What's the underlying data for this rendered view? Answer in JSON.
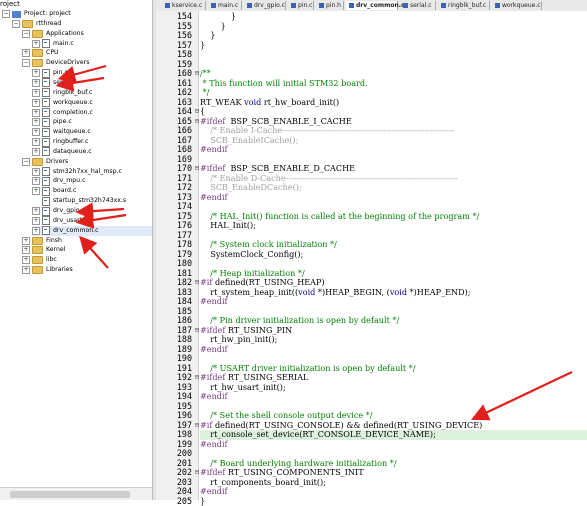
{
  "project_pane": {
    "title": "roject",
    "tree": [
      {
        "label": "Project: project",
        "kind": "project",
        "indent": 0,
        "pm": "-"
      },
      {
        "label": "rtthread",
        "kind": "folder",
        "indent": 1,
        "pm": "-"
      },
      {
        "label": "Applications",
        "kind": "folder",
        "indent": 2,
        "pm": "-"
      },
      {
        "label": "main.c",
        "kind": "file",
        "indent": 3,
        "pm": "+"
      },
      {
        "label": "CPU",
        "kind": "folder",
        "indent": 2,
        "pm": "+"
      },
      {
        "label": "DeviceDrivers",
        "kind": "folder",
        "indent": 2,
        "pm": "-"
      },
      {
        "label": "pin.c",
        "kind": "file",
        "indent": 3,
        "pm": "+"
      },
      {
        "label": "serial.c",
        "kind": "file",
        "indent": 3,
        "pm": "+"
      },
      {
        "label": "ringblk_buf.c",
        "kind": "file",
        "indent": 3,
        "pm": "+"
      },
      {
        "label": "workqueue.c",
        "kind": "file",
        "indent": 3,
        "pm": "+"
      },
      {
        "label": "completion.c",
        "kind": "file",
        "indent": 3,
        "pm": "+"
      },
      {
        "label": "pipe.c",
        "kind": "file",
        "indent": 3,
        "pm": "+"
      },
      {
        "label": "waitqueue.c",
        "kind": "file",
        "indent": 3,
        "pm": "+"
      },
      {
        "label": "ringbuffer.c",
        "kind": "file",
        "indent": 3,
        "pm": "+"
      },
      {
        "label": "dataqueue.c",
        "kind": "file",
        "indent": 3,
        "pm": "+"
      },
      {
        "label": "Drivers",
        "kind": "folder",
        "indent": 2,
        "pm": "-"
      },
      {
        "label": "stm32h7xx_hal_msp.c",
        "kind": "file",
        "indent": 3,
        "pm": "+"
      },
      {
        "label": "drv_mpu.c",
        "kind": "file",
        "indent": 3,
        "pm": "+"
      },
      {
        "label": "board.c",
        "kind": "file",
        "indent": 3,
        "pm": "+"
      },
      {
        "label": "startup_stm32h743xx.s",
        "kind": "file",
        "indent": 3,
        "pm": ""
      },
      {
        "label": "drv_gpio.c",
        "kind": "file",
        "indent": 3,
        "pm": "+"
      },
      {
        "label": "drv_usart.c",
        "kind": "file",
        "indent": 3,
        "pm": "+"
      },
      {
        "label": "drv_common.c",
        "kind": "file",
        "indent": 3,
        "pm": "+",
        "selected": true
      },
      {
        "label": "Finsh",
        "kind": "folder",
        "indent": 2,
        "pm": "+"
      },
      {
        "label": "Kernel",
        "kind": "folder",
        "indent": 2,
        "pm": "+"
      },
      {
        "label": "libc",
        "kind": "folder",
        "indent": 2,
        "pm": "+"
      },
      {
        "label": "Libraries",
        "kind": "folder",
        "indent": 2,
        "pm": "+"
      }
    ]
  },
  "tabs": [
    {
      "label": "kservice.c",
      "active": false
    },
    {
      "label": "main.c",
      "active": false
    },
    {
      "label": "drv_gpio.c",
      "active": false
    },
    {
      "label": "pin.c",
      "active": false
    },
    {
      "label": "pin.h",
      "active": false
    },
    {
      "label": "drv_common.c",
      "active": true
    },
    {
      "label": "serial.c",
      "active": false
    },
    {
      "label": "ringblk_buf.c",
      "active": false
    },
    {
      "label": "workqueue.c",
      "active": false
    }
  ],
  "editor": {
    "lines": [
      {
        "n": "154",
        "fm": "",
        "html": "            }"
      },
      {
        "n": "155",
        "fm": "",
        "html": "        }"
      },
      {
        "n": "156",
        "fm": "",
        "html": "    }"
      },
      {
        "n": "157",
        "fm": "",
        "html": "}"
      },
      {
        "n": "158",
        "fm": "",
        "html": ""
      },
      {
        "n": "159",
        "fm": "",
        "html": ""
      },
      {
        "n": "160",
        "fm": "⊟",
        "html": "<span class=\"cm\">/**</span>"
      },
      {
        "n": "161",
        "fm": "",
        "html": "<span class=\"cm\"> * This function will initial STM32 board.</span>"
      },
      {
        "n": "162",
        "fm": "",
        "html": "<span class=\"cm\"> */</span>"
      },
      {
        "n": "163",
        "fm": "",
        "html": "RT_WEAK <span class=\"kw\">void</span> rt_hw_board_init()"
      },
      {
        "n": "164",
        "fm": "⊟",
        "html": "{"
      },
      {
        "n": "165",
        "fm": "⊟",
        "html": "<span class=\"pp\">#ifdef</span>  BSP_SCB_ENABLE_I_CACHE"
      },
      {
        "n": "166",
        "fm": "",
        "html": "    <span class=\"gray\">/* Enable I-Cache---------------------------------------------------------------</span>"
      },
      {
        "n": "167",
        "fm": "",
        "html": "    <span class=\"gray\">SCB_EnableICache();</span>"
      },
      {
        "n": "168",
        "fm": "",
        "html": "<span class=\"pp\">#endif</span>"
      },
      {
        "n": "169",
        "fm": "",
        "html": ""
      },
      {
        "n": "170",
        "fm": "⊟",
        "html": "<span class=\"pp\">#ifdef</span>  BSP_SCB_ENABLE_D_CACHE"
      },
      {
        "n": "171",
        "fm": "",
        "html": "    <span class=\"gray\">/* Enable D-Cache---------------------------------------------------------------</span>"
      },
      {
        "n": "172",
        "fm": "",
        "html": "    <span class=\"gray\">SCB_EnableDCache();</span>"
      },
      {
        "n": "173",
        "fm": "",
        "html": "<span class=\"pp\">#endif</span>"
      },
      {
        "n": "174",
        "fm": "",
        "html": ""
      },
      {
        "n": "175",
        "fm": "",
        "html": "    <span class=\"cm\">/* HAL_Init() function is called at the beginning of the program */</span>"
      },
      {
        "n": "176",
        "fm": "",
        "html": "    HAL_Init();"
      },
      {
        "n": "177",
        "fm": "",
        "html": ""
      },
      {
        "n": "178",
        "fm": "",
        "html": "    <span class=\"cm\">/* System clock initialization */</span>"
      },
      {
        "n": "179",
        "fm": "",
        "html": "    SystemClock_Config();"
      },
      {
        "n": "180",
        "fm": "",
        "html": ""
      },
      {
        "n": "181",
        "fm": "",
        "html": "    <span class=\"cm\">/* Heap initialization */</span>"
      },
      {
        "n": "182",
        "fm": "⊟",
        "html": "<span class=\"pp\">#if</span> defined(RT_USING_HEAP)"
      },
      {
        "n": "183",
        "fm": "",
        "html": "    rt_system_heap_init((<span class=\"kw\">void</span> *)HEAP_BEGIN, (<span class=\"kw\">void</span> *)HEAP_END);"
      },
      {
        "n": "184",
        "fm": "",
        "html": "<span class=\"pp\">#endif</span>"
      },
      {
        "n": "185",
        "fm": "",
        "html": ""
      },
      {
        "n": "186",
        "fm": "",
        "html": "    <span class=\"cm\">/* Pin driver initialization is open by default */</span>"
      },
      {
        "n": "187",
        "fm": "⊟",
        "html": "<span class=\"pp\">#ifdef</span> RT_USING_PIN"
      },
      {
        "n": "188",
        "fm": "",
        "html": "    rt_hw_pin_init();"
      },
      {
        "n": "189",
        "fm": "",
        "html": "<span class=\"pp\">#endif</span>"
      },
      {
        "n": "190",
        "fm": "",
        "html": ""
      },
      {
        "n": "191",
        "fm": "",
        "html": "    <span class=\"cm\">/* USART driver initialization is open by default */</span>"
      },
      {
        "n": "192",
        "fm": "⊟",
        "html": "<span class=\"pp\">#ifdef</span> RT_USING_SERIAL"
      },
      {
        "n": "193",
        "fm": "",
        "html": "    rt_hw_usart_init();"
      },
      {
        "n": "194",
        "fm": "",
        "html": "<span class=\"pp\">#endif</span>"
      },
      {
        "n": "195",
        "fm": "",
        "html": ""
      },
      {
        "n": "196",
        "fm": "",
        "html": "    <span class=\"cm\">/* Set the shell console output device */</span>"
      },
      {
        "n": "197",
        "fm": "⊟",
        "html": "<span class=\"pp\">#if</span> defined(RT_USING_CONSOLE) &amp;&amp; defined(RT_USING_DEVICE)"
      },
      {
        "n": "198",
        "fm": "",
        "html": "    rt_console_set_device(RT_CONSOLE_DEVICE_NAME);",
        "highlight": true
      },
      {
        "n": "199",
        "fm": "",
        "html": "<span class=\"pp\">#endif</span>"
      },
      {
        "n": "200",
        "fm": "",
        "html": ""
      },
      {
        "n": "201",
        "fm": "",
        "html": "    <span class=\"cm\">/* Board underlying hardware initialization */</span>"
      },
      {
        "n": "202",
        "fm": "⊟",
        "html": "<span class=\"pp\">#ifdef</span> RT_USING_COMPONENTS_INIT"
      },
      {
        "n": "203",
        "fm": "",
        "html": "    rt_components_board_init();"
      },
      {
        "n": "204",
        "fm": "",
        "html": "<span class=\"pp\">#endif</span>"
      },
      {
        "n": "205",
        "fm": "",
        "html": "}"
      }
    ]
  },
  "colors": {
    "arrow": "#e0201c",
    "highlight_line": "#dcf2dc",
    "comment": "#008000",
    "keyword": "#00008b"
  }
}
